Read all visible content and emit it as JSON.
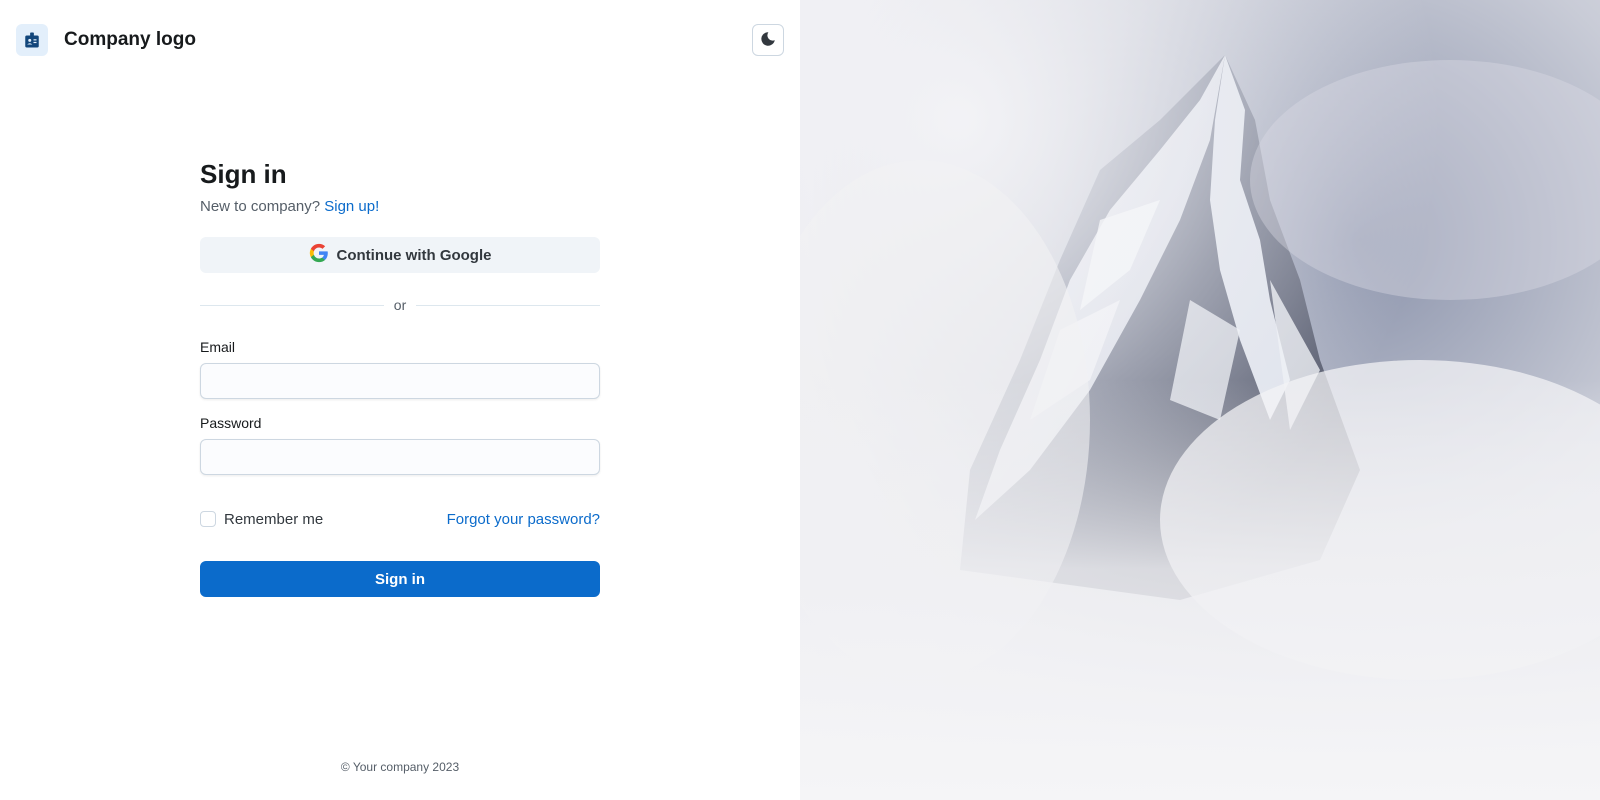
{
  "header": {
    "brand_icon": "badge-icon",
    "brand_name": "Company logo",
    "theme_toggle_icon": "moon-icon"
  },
  "signin": {
    "title": "Sign in",
    "subtitle_prefix": "New to company?",
    "signup_link": "Sign up!",
    "google_button": "Continue with Google",
    "divider_text": "or",
    "email_label": "Email",
    "email_value": "",
    "password_label": "Password",
    "password_value": "",
    "remember_label": "Remember me",
    "forgot_link": "Forgot your password?",
    "submit_label": "Sign in"
  },
  "footer": {
    "copyright": "© Your company 2023"
  },
  "hero_image": {
    "subject": "snow-covered mountain peak in clouds"
  },
  "colors": {
    "accent": "#0b6bcb",
    "google_button_bg": "#f0f4f8",
    "brand_badge_bg": "#e3effb"
  }
}
